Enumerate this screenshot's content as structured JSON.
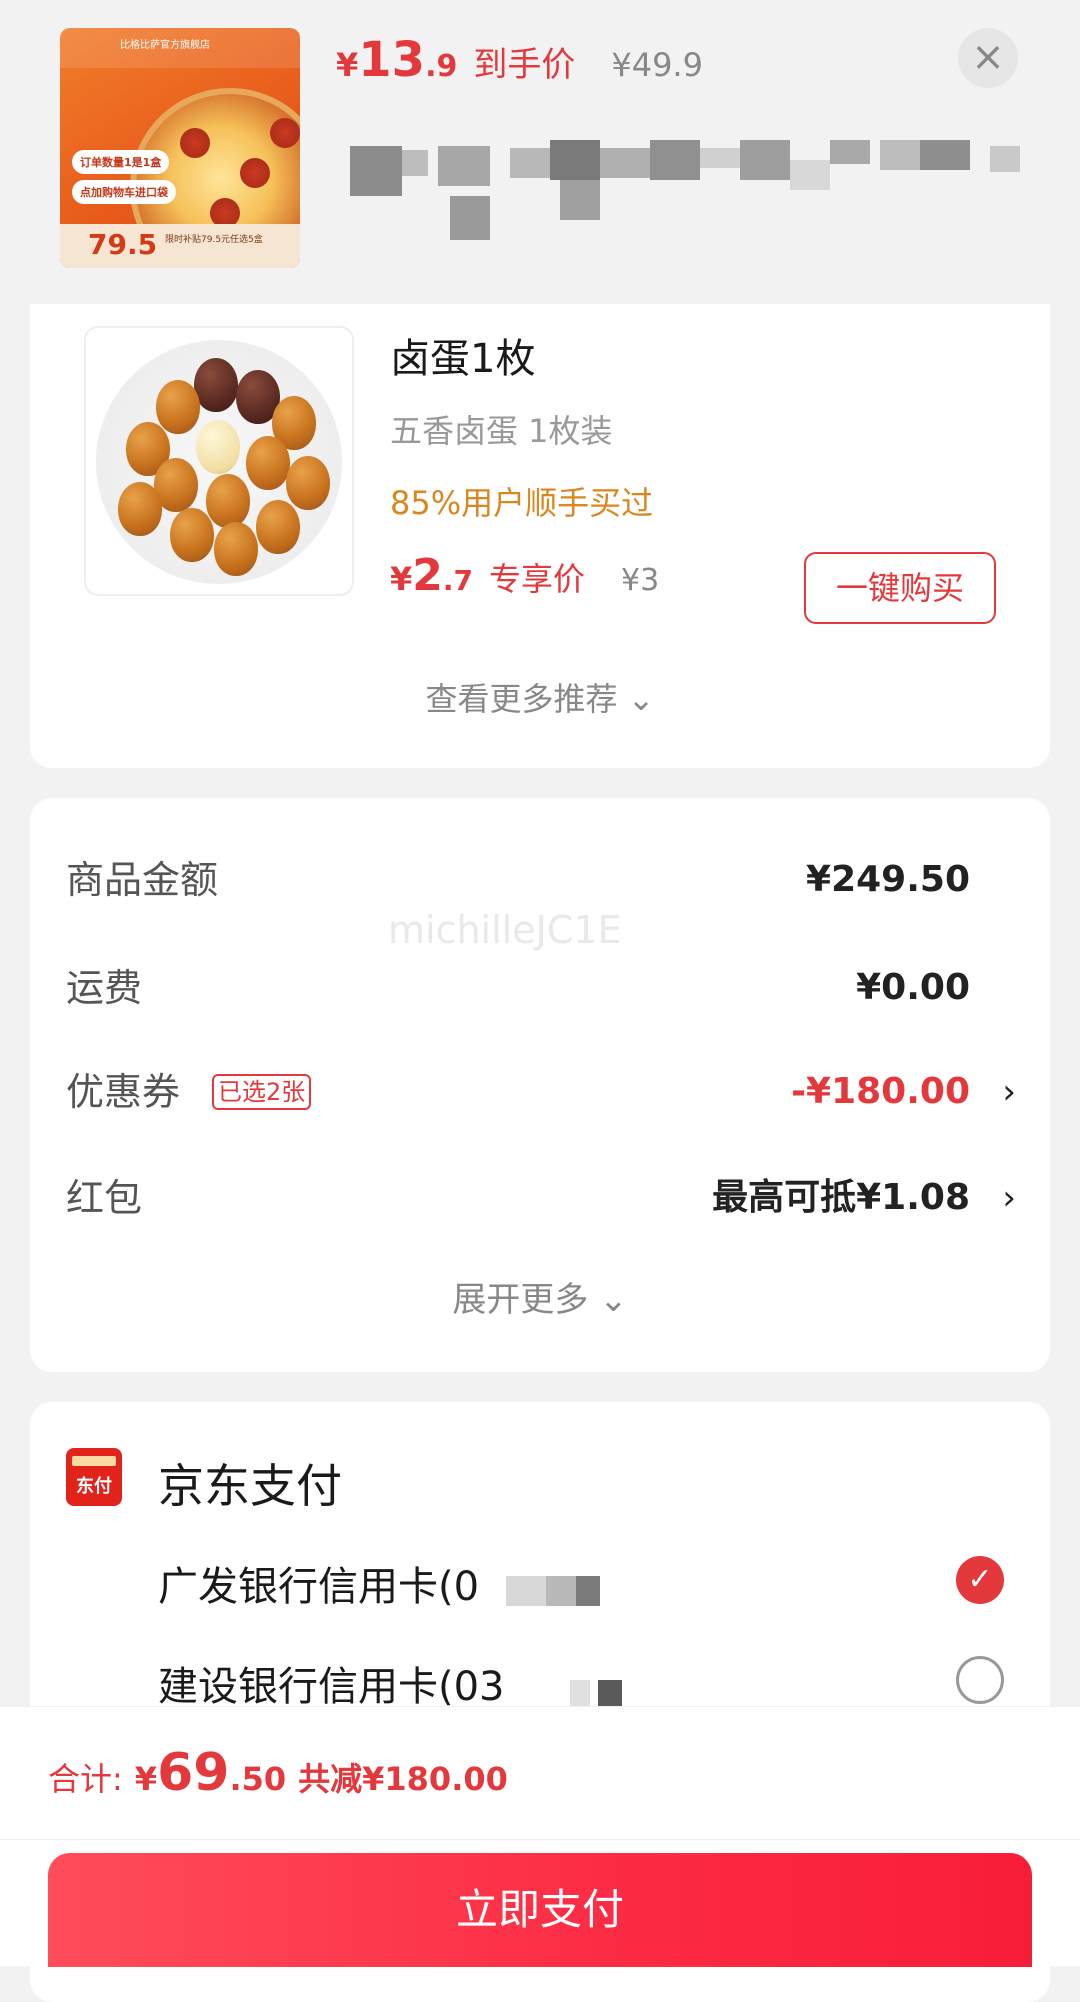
{
  "header": {
    "thumb": {
      "brand": "比格比萨官方旗舰店",
      "promo1": "订单数量1是1盒",
      "promo2": "点加购物车进口袋",
      "badge_price": "79.5",
      "badge_note": "限时补贴79.5元任选5盒"
    },
    "price_yen": "¥",
    "price_int": "13",
    "price_dec": ".9",
    "price_label": "到手价",
    "original_price": "¥49.9",
    "close_symbol": "×"
  },
  "product": {
    "title": "卤蛋1枚",
    "spec": "五香卤蛋   1枚装",
    "social_proof": "85%用户顺手买过",
    "price_yen": "¥",
    "price_int": "2",
    "price_dec": ".7",
    "price_label": "专享价",
    "original_price": "¥3",
    "buy_button": "一键购买",
    "more_link": "查看更多推荐 ⌄"
  },
  "fees": {
    "watermark": "michilleJC1E",
    "rows": [
      {
        "label": "商品金额",
        "value": "¥249.50"
      },
      {
        "label": "运费",
        "value": "¥0.00"
      },
      {
        "label": "优惠券",
        "tag": "已选2张",
        "value": "-¥180.00",
        "arrow": "›"
      },
      {
        "label": "红包",
        "value": "最高可抵¥1.08",
        "arrow": "›"
      }
    ],
    "expand_link": "展开更多 ⌄"
  },
  "payment": {
    "icon_text": "东付",
    "title": "京东支付",
    "options": [
      {
        "label": "广发银行信用卡(0",
        "selected": true
      },
      {
        "label": "建设银行信用卡(03",
        "selected": false
      }
    ],
    "check_symbol": "✓"
  },
  "footer": {
    "total_label": "合计:",
    "total_yen": "¥",
    "total_int": "69",
    "total_dec": ".50",
    "saved": "共减¥180.00",
    "pay_button": "立即支付"
  },
  "colors": {
    "accent": "#e4393c",
    "social_proof": "#d9871f",
    "pay_button": "#fc2a43"
  }
}
